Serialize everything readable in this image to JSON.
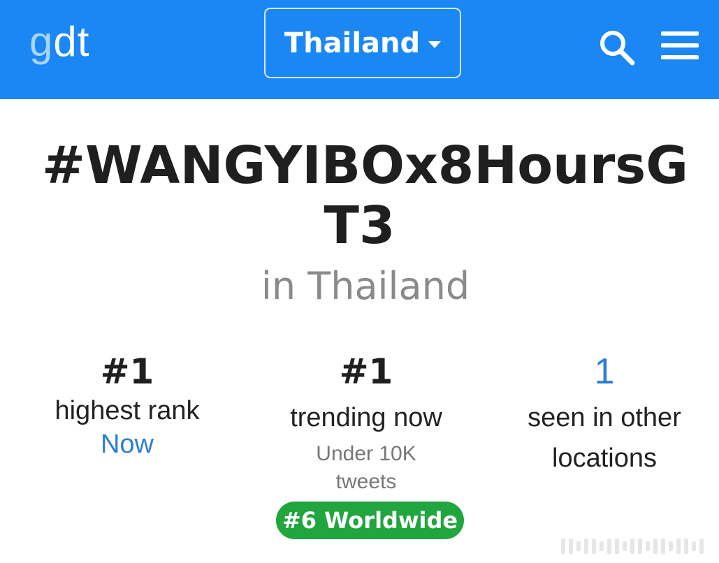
{
  "header": {
    "logo_g": "g",
    "logo_dt": "dt",
    "country_selector": "Thailand",
    "search_icon": "search-icon",
    "menu_icon": "hamburger-menu-icon",
    "bg_color": "#1a87f5"
  },
  "trend": {
    "title_line1": "#WANGYIBOx8HoursG",
    "title_line2": "T3",
    "location": "in Thailand"
  },
  "stats": {
    "highest_rank": {
      "value": "#1",
      "label": "highest rank",
      "when": "Now"
    },
    "trending_now": {
      "value": "#1",
      "label": "trending now",
      "tweets_line1": "Under 10K",
      "tweets_line2": "tweets",
      "worldwide_badge": "#6 Worldwide",
      "badge_color": "#21a53f"
    },
    "other_locations": {
      "value": "1",
      "label_line1": "seen in other",
      "label_line2": "locations"
    }
  }
}
